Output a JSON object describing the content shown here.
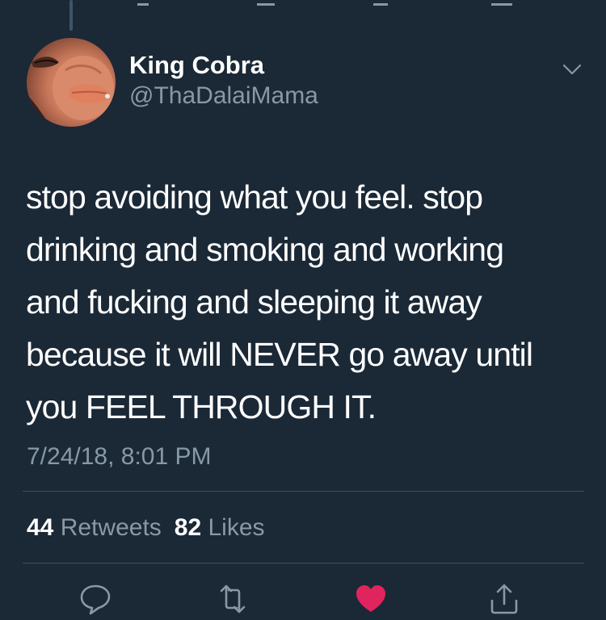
{
  "tweet": {
    "author": {
      "display_name": "King Cobra",
      "handle": "@ThaDalaiMama"
    },
    "text": "stop avoiding what you feel. stop\ndrinking and smoking and working\nand fucking and sleeping it away\nbecause it will NEVER go away until\nyou FEEL THROUGH IT.",
    "timestamp": "7/24/18, 8:01 PM",
    "stats": {
      "retweets_count": "44",
      "retweets_label": "Retweets",
      "likes_count": "82",
      "likes_label": "Likes"
    },
    "liked": true
  },
  "colors": {
    "background": "#1b2836",
    "secondary_text": "#8899a6",
    "like_active": "#e0245e",
    "divider": "#3d4f5f"
  },
  "icons": {
    "actions": [
      "reply-icon",
      "retweet-icon",
      "like-icon",
      "share-icon"
    ],
    "menu": "chevron-down-icon"
  }
}
